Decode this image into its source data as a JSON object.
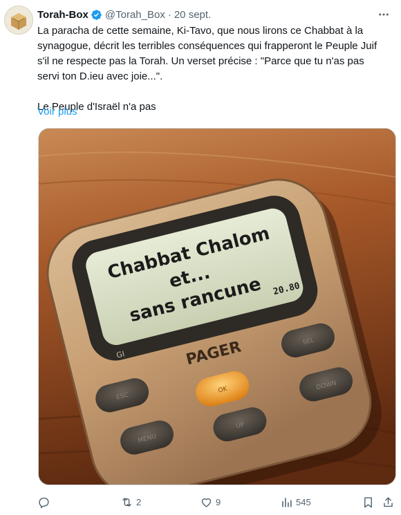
{
  "tweet": {
    "author_name": "Torah-Box",
    "handle": "@Torah_Box",
    "separator": "·",
    "date": "20 sept.",
    "text_paragraph_1": "La paracha de cette semaine, Ki-Tavo, que nous lirons ce Chabbat à la synagogue, décrit les terribles conséquences qui frapperont le Peuple Juif s'il ne respecte pas la Torah. Un verset précise : \"Parce que tu n'as pas servi ton D.ieu avec joie...\".",
    "text_paragraph_2": "Le Peuple d'Israël n'a pas",
    "see_more": "Voir plus"
  },
  "media": {
    "screen_line_1": "Chabbat Chalom",
    "screen_line_2": "et...",
    "screen_line_3": "sans rancune",
    "screen_time": "20.80",
    "screen_small": "GI",
    "brand_label": "PAGER",
    "button_labels": [
      "ESC",
      "SEL",
      "MENU",
      "OK",
      "UP",
      "DOWN"
    ]
  },
  "actions": {
    "reply_count": "",
    "retweet_count": "2",
    "like_count": "9",
    "views_count": "545"
  },
  "icons": {
    "verified": "verified-badge-icon",
    "more": "more-options-icon",
    "reply": "reply-icon",
    "retweet": "retweet-icon",
    "like": "heart-icon",
    "views": "views-chart-icon",
    "bookmark": "bookmark-icon",
    "share": "share-icon"
  },
  "colors": {
    "link": "#1d9bf0",
    "secondary_text": "#536471",
    "verified": "#1d9bf0",
    "pager_button_accent": "#f0a020"
  }
}
